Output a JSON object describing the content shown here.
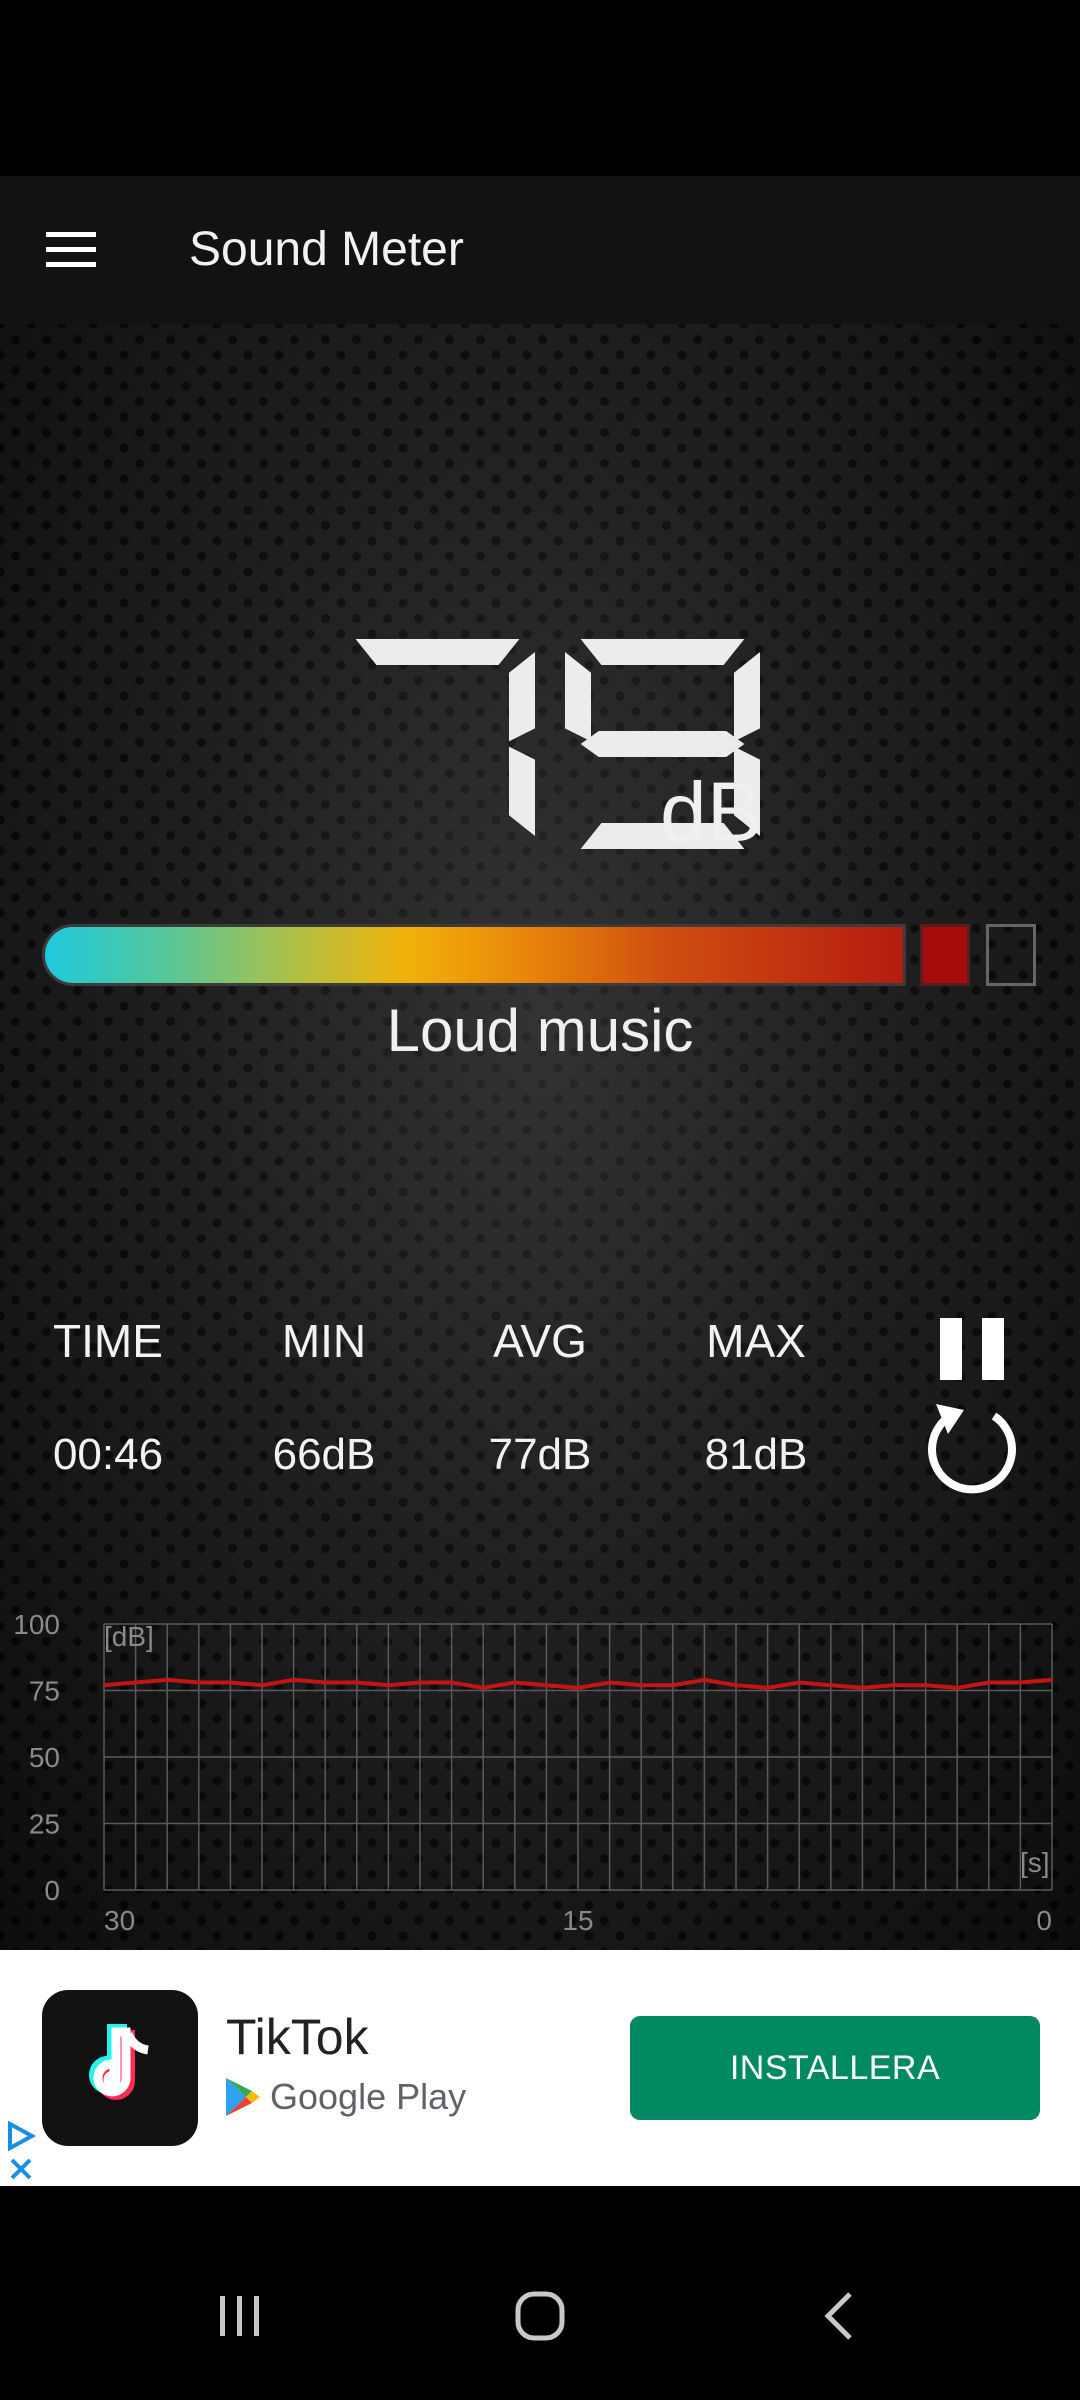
{
  "app_bar": {
    "title": "Sound Meter",
    "menu_icon": "hamburger-menu-icon"
  },
  "meter": {
    "reading": "79",
    "unit": "dB",
    "level_label": "Loud music",
    "level_fraction": 0.9
  },
  "stats": {
    "time": {
      "label": "TIME",
      "value": "00:46"
    },
    "min": {
      "label": "MIN",
      "value": "66dB"
    },
    "avg": {
      "label": "AVG",
      "value": "77dB"
    },
    "max": {
      "label": "MAX",
      "value": "81dB"
    },
    "pause_icon": "pause-icon",
    "reset_icon": "refresh-icon"
  },
  "chart_data": {
    "type": "line",
    "ylabel": "[dB]",
    "xlabel": "[s]",
    "ylim": [
      0,
      100
    ],
    "xlim": [
      30,
      0
    ],
    "y_ticks": [
      "100",
      "75",
      "50",
      "25",
      "0"
    ],
    "x_ticks": [
      "30",
      "15",
      "0"
    ],
    "grid": true,
    "series": [
      {
        "color": "#c41414",
        "x": [
          30,
          29,
          28,
          27,
          26,
          25,
          24,
          23,
          22,
          21,
          20,
          19,
          18,
          17,
          16,
          15,
          14,
          13,
          12,
          11,
          10,
          9,
          8,
          7,
          6,
          5,
          4,
          3,
          2,
          1,
          0
        ],
        "y": [
          77,
          78,
          79,
          78,
          78,
          77,
          79,
          78,
          78,
          77,
          78,
          78,
          76,
          78,
          77,
          76,
          78,
          77,
          77,
          79,
          77,
          76,
          78,
          77,
          76,
          77,
          77,
          76,
          78,
          78,
          79
        ]
      }
    ]
  },
  "ad": {
    "app_name": "TikTok",
    "store_name": "Google Play",
    "install_label": "INSTALLERA",
    "app_icon": "tiktok-logo-icon",
    "store_icon": "google-play-icon",
    "adchoices_icon": "adchoices-icon",
    "close_icon": "close-icon"
  },
  "nav": {
    "recents_icon": "recents-icon",
    "home_icon": "home-icon",
    "back_icon": "back-icon"
  }
}
